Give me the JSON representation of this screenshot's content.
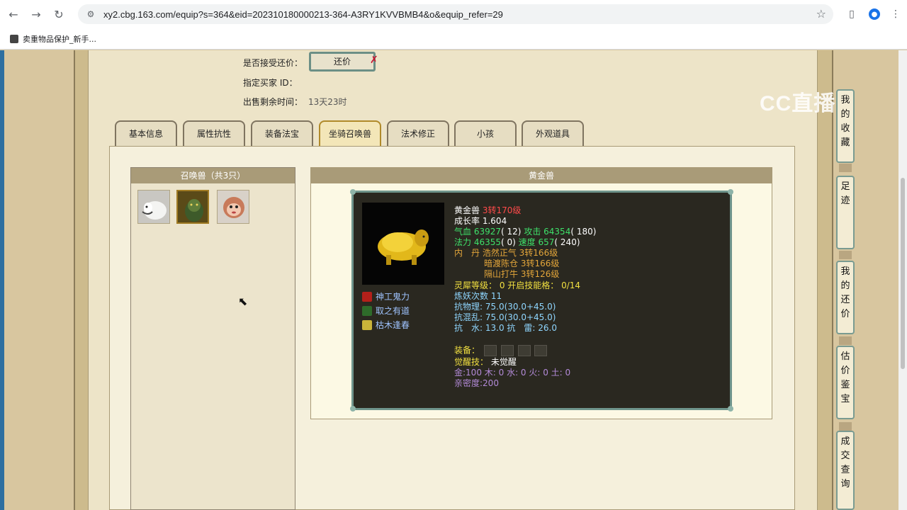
{
  "browser": {
    "url": "xy2.cbg.163.com/equip?s=364&eid=202310180000213-364-A3RY1KVVBMB4&o&equip_refer=29",
    "bookmark_label": "卖重物品保护_新手..."
  },
  "sale_info": {
    "accept_counter_label": "是否接受还价：",
    "counter_button": "还价",
    "buyer_id_label": "指定买家 ID：",
    "time_left_label": "出售剩余时间：",
    "time_left_value": "13天23时"
  },
  "tabs": [
    "基本信息",
    "属性抗性",
    "装备法宝",
    "坐骑召唤兽",
    "法术修正",
    "小孩",
    "外观道具"
  ],
  "active_tab": "坐骑召唤兽",
  "pet_list": {
    "header": "召唤兽（共3只）"
  },
  "pet_detail": {
    "header": "黄金兽",
    "skills": [
      "神工鬼力",
      "取之有道",
      "枯木逢春"
    ],
    "name": "黄金兽",
    "level": "3转170级",
    "growth_label": "成长率",
    "growth_value": "1.604",
    "hp_label": "气血",
    "hp_value": "63927",
    "hp_extra": "( 12)",
    "atk_label": "攻击",
    "atk_value": "64354",
    "atk_extra": "( 180)",
    "mp_label": "法力",
    "mp_value": "46355",
    "mp_extra": "( 0)",
    "spd_label": "速度",
    "spd_value": "657",
    "spd_extra": "( 240)",
    "dan_label": "内　丹",
    "dan_1": "浩然正气 3转166级",
    "dan_2": "暗渡陈仓 3转166级",
    "dan_3": "隔山打牛 3转126级",
    "spirit_line": "灵犀等级： 0 开启技能格： 0/14",
    "refine_line": "炼妖次数 11",
    "resist_phys": "抗物理: 75.0(30.0+45.0)",
    "resist_chaos": "抗混乱: 75.0(30.0+45.0)",
    "resist_elem": "抗　水: 13.0 抗　雷: 26.0",
    "equip_label": "装备：",
    "awaken_label": "觉醒技：",
    "awaken_value": "未觉醒",
    "elements": "金:100 木: 0 水: 0 火: 0 土: 0",
    "intimacy": "亲密度:200"
  },
  "watermark": "CC直播",
  "side_nav": [
    "我的收藏",
    "足迹",
    "我的还价",
    "估价鉴宝",
    "成交查询"
  ]
}
